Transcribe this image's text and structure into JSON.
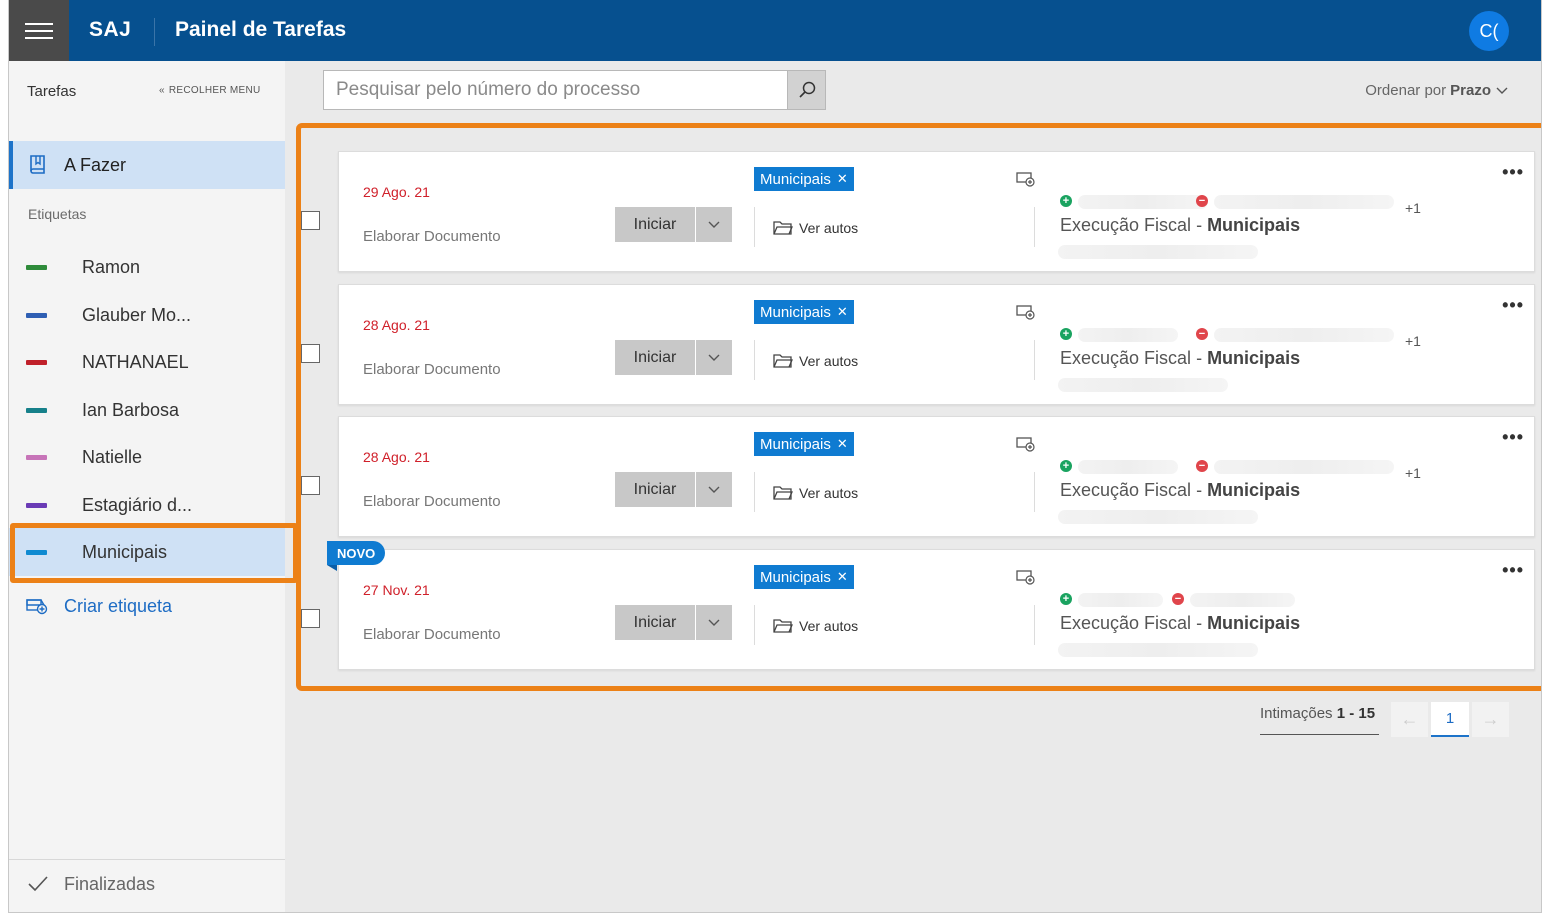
{
  "header": {
    "brand": "SAJ",
    "title": "Painel de Tarefas",
    "avatar_initials": "C("
  },
  "sidebar": {
    "title": "Tarefas",
    "collapse_label": "RECOLHER MENU",
    "todo_label": "A Fazer",
    "labels_title": "Etiquetas",
    "tags": [
      {
        "name": "Ramon",
        "color": "#2e8b3a"
      },
      {
        "name": "Glauber Mo...",
        "color": "#2f5fb3"
      },
      {
        "name": "NATHANAEL",
        "color": "#c0202a"
      },
      {
        "name": "Ian Barbosa",
        "color": "#16808a"
      },
      {
        "name": "Natielle",
        "color": "#c774b8"
      },
      {
        "name": "Estagiário d...",
        "color": "#6a3bb5"
      },
      {
        "name": "Municipais",
        "color": "#0f8ad1"
      }
    ],
    "create_label": "Criar etiqueta",
    "done_label": "Finalizadas"
  },
  "search": {
    "placeholder": "Pesquisar pelo número do processo"
  },
  "order": {
    "label": "Ordenar por",
    "value": "Prazo"
  },
  "cards": [
    {
      "date": "29 Ago. 21",
      "type": "Elaborar Documento",
      "start_label": "Iniciar",
      "tag": "Municipais",
      "autos_label": "Ver autos",
      "extra": "+1",
      "class_prefix": "Execução Fiscal",
      "class_sep": " - ",
      "class_name": "Municipais"
    },
    {
      "date": "28 Ago. 21",
      "type": "Elaborar Documento",
      "start_label": "Iniciar",
      "tag": "Municipais",
      "autos_label": "Ver autos",
      "extra": "+1",
      "class_prefix": "Execução Fiscal",
      "class_sep": " - ",
      "class_name": "Municipais"
    },
    {
      "date": "28 Ago. 21",
      "type": "Elaborar Documento",
      "start_label": "Iniciar",
      "tag": "Municipais",
      "autos_label": "Ver autos",
      "extra": "+1",
      "class_prefix": "Execução Fiscal",
      "class_sep": " - ",
      "class_name": "Municipais"
    },
    {
      "date": "27 Nov. 21",
      "type": "Elaborar Documento",
      "start_label": "Iniciar",
      "tag": "Municipais",
      "autos_label": "Ver autos",
      "extra": "",
      "class_prefix": "Execução Fiscal",
      "class_sep": " - ",
      "class_name": "Municipais",
      "badge": "NOVO"
    }
  ],
  "pagination": {
    "label": "Intimações",
    "range": "1 - 15",
    "current_page": "1"
  },
  "colors": {
    "header": "#06508f",
    "accent": "#0f7bd1",
    "highlight": "#ec8117",
    "date": "#d0202a"
  }
}
